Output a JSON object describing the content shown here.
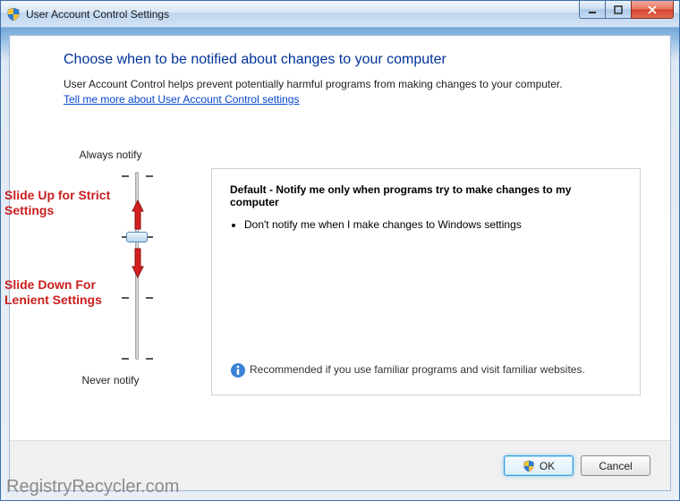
{
  "window": {
    "title": "User Account Control Settings"
  },
  "page": {
    "heading": "Choose when to be notified about changes to your computer",
    "description": "User Account Control helps prevent potentially harmful programs from making changes to your computer.",
    "link": "Tell me more about User Account Control settings"
  },
  "slider": {
    "top_label": "Always notify",
    "bottom_label": "Never notify",
    "levels": 4,
    "current_level": 2
  },
  "annotations": {
    "up": "Slide Up for Strict Settings",
    "down": "Slide Down For Lenient Settings"
  },
  "info": {
    "title": "Default - Notify me only when programs try to make changes to my computer",
    "bullets": [
      "Don't notify me when I make changes to Windows settings"
    ],
    "recommendation": "Recommended if you use familiar programs and visit familiar websites."
  },
  "buttons": {
    "ok": "OK",
    "cancel": "Cancel"
  },
  "watermark": "RegistryRecycler.com"
}
